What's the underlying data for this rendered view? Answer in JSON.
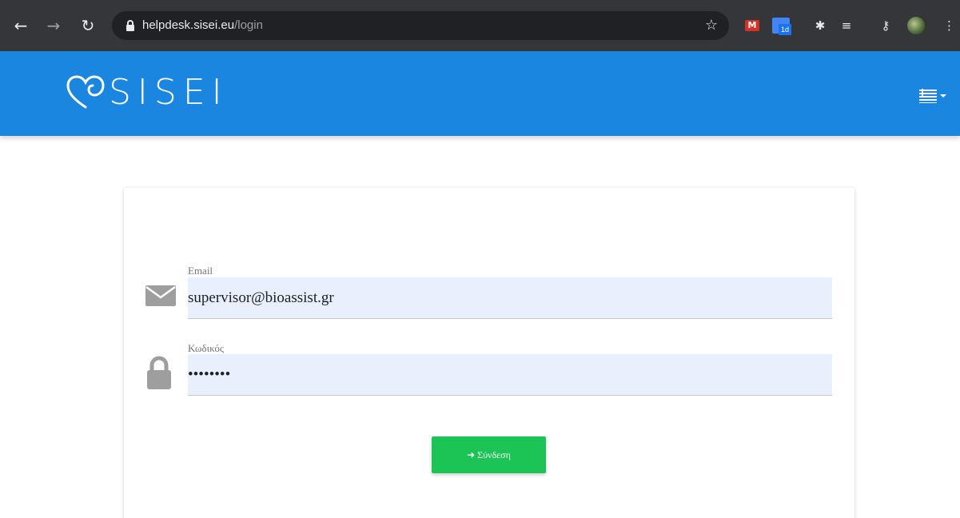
{
  "browser": {
    "url_host": "helpdesk.sisei.eu",
    "url_path": "/login",
    "icons": [
      "back-icon",
      "forward-icon",
      "reload-icon",
      "lock-icon",
      "star-icon",
      "gmail-icon",
      "calendar-icon",
      "puzzle-icon",
      "media-icon",
      "key-icon",
      "profile-avatar",
      "menu-icon"
    ],
    "calendar_badge": "1d"
  },
  "header": {
    "logo_text": "SISEI",
    "language_icon": "greek-flag-icon",
    "bg_color": "#1a86e0"
  },
  "login": {
    "email_label": "Email",
    "email_value": "supervisor@bioassist.gr",
    "password_label": "Κωδικός",
    "password_value": "password",
    "submit_label": "Σύνδεση",
    "submit_color": "#1cc456"
  }
}
